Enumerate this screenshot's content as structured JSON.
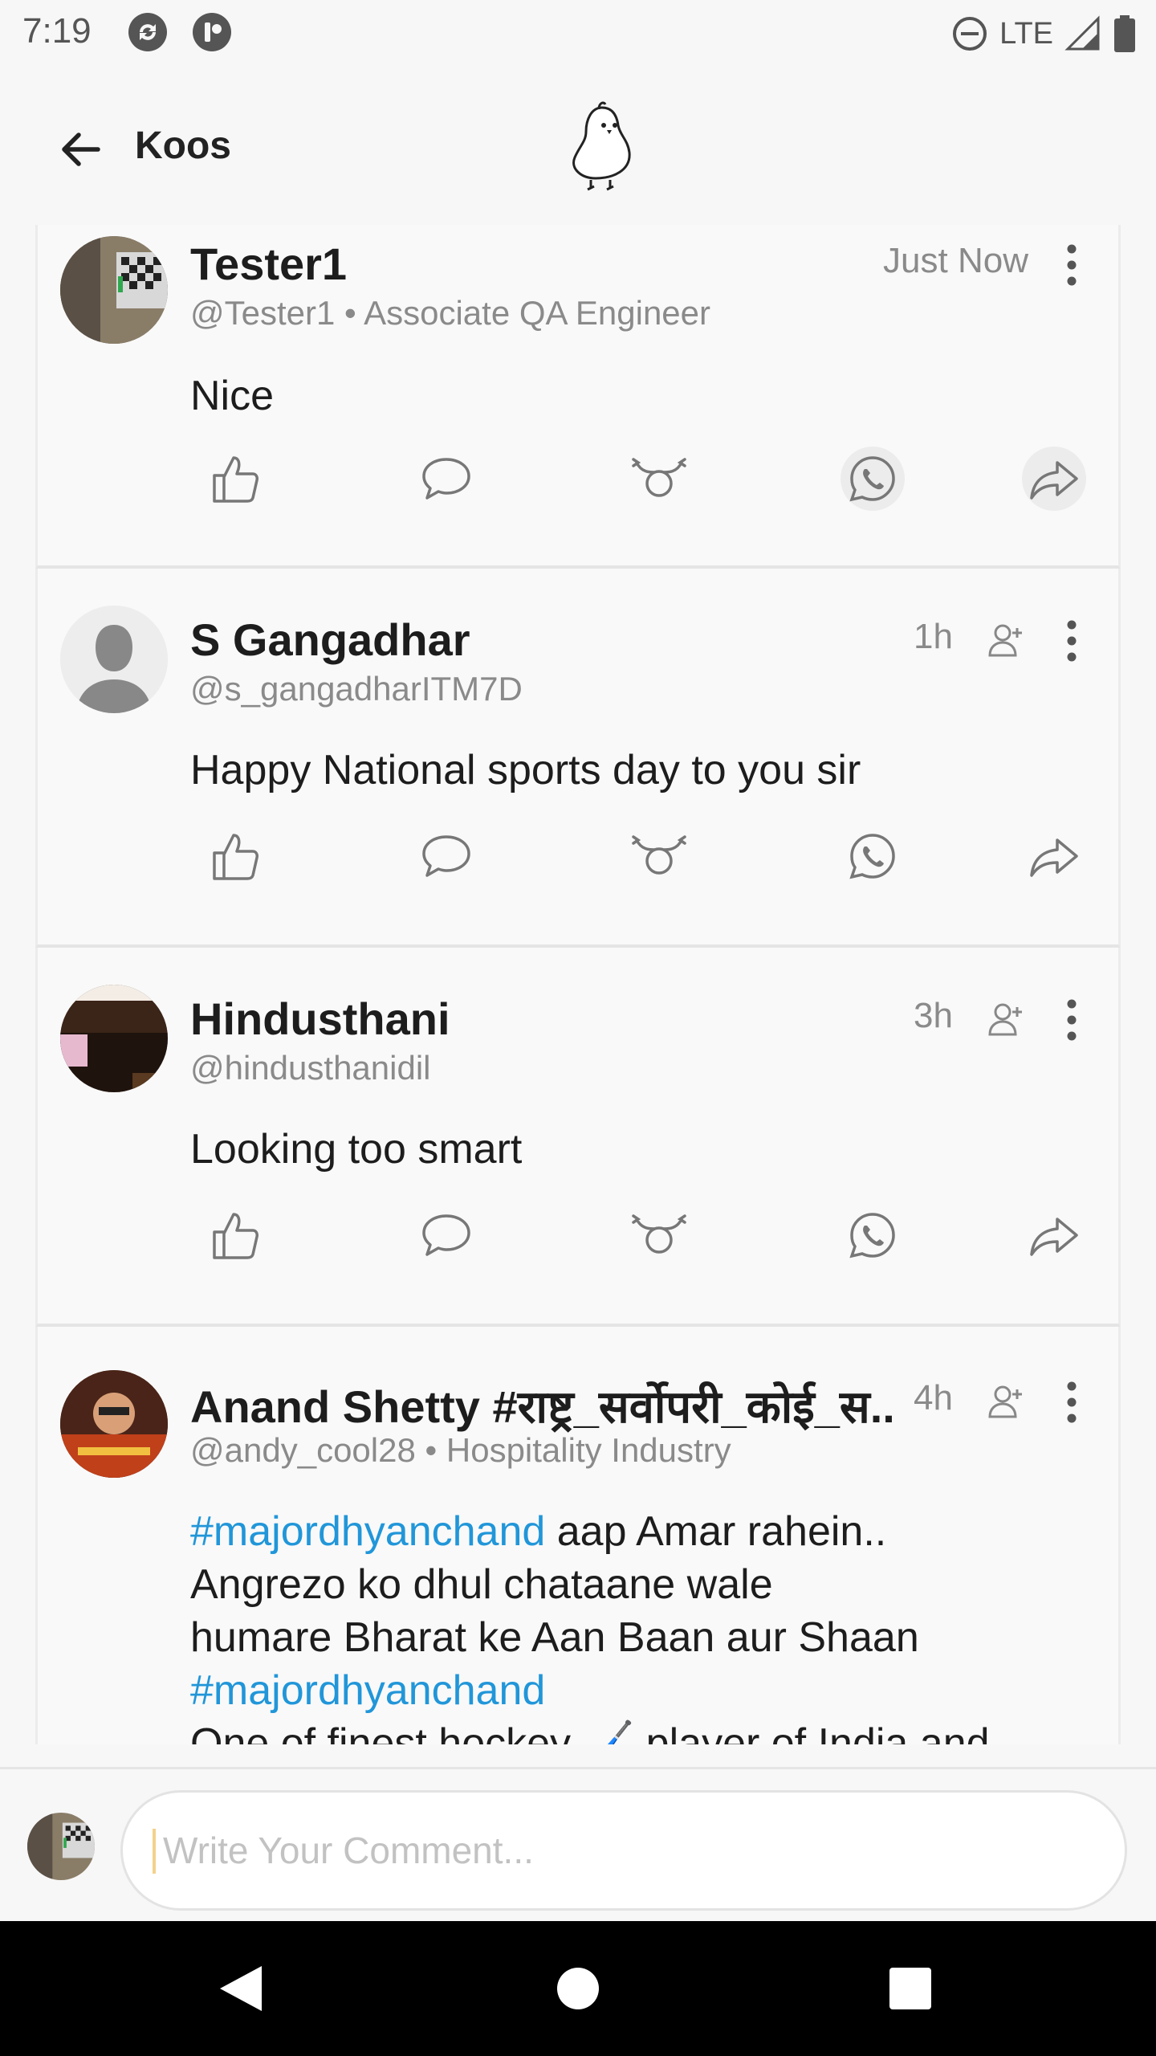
{
  "status_bar": {
    "time": "7:19",
    "network": "LTE",
    "icons": [
      "sync-icon",
      "app-badge-icon",
      "do-not-disturb-icon",
      "signal-icon",
      "battery-icon"
    ]
  },
  "header": {
    "title": "Koos",
    "back_icon": "arrow-left-icon",
    "logo": "koo-bird-logo"
  },
  "colors": {
    "hashtag": "#2196d9",
    "text": "#1d1d1d",
    "muted": "#8a8a8a",
    "nav_bg": "#000000"
  },
  "comments": [
    {
      "name": "Tester1",
      "handle": "@Tester1 • Associate QA Engineer",
      "time": "Just Now",
      "text": "Nice"
    },
    {
      "name": "S Gangadhar",
      "handle": "@s_gangadharITM7D",
      "time": "1h",
      "text": "Happy National sports day to you sir"
    },
    {
      "name": "Hindusthani",
      "handle": "@hindusthanidil",
      "time": "3h",
      "text": "Looking too smart"
    },
    {
      "name": "Anand Shetty #राष्ट्र_सर्वोपरी_कोई_स...",
      "handle": "@andy_cool28 • Hospitality Industry",
      "time": "4h",
      "text_hashtag_1": "#majordhyanchand",
      "text_line_1": " aap Amar rahein..",
      "text_line_2": "Angrezo ko dhul chataane wale",
      "text_line_3": "humare Bharat ke Aan Baan aur Shaan",
      "text_hashtag_2": "#majordhyanchand",
      "text_line_5": "One of finest hockey 🏑 player of India and"
    }
  ],
  "comment_box": {
    "placeholder": "Write Your Comment..."
  }
}
